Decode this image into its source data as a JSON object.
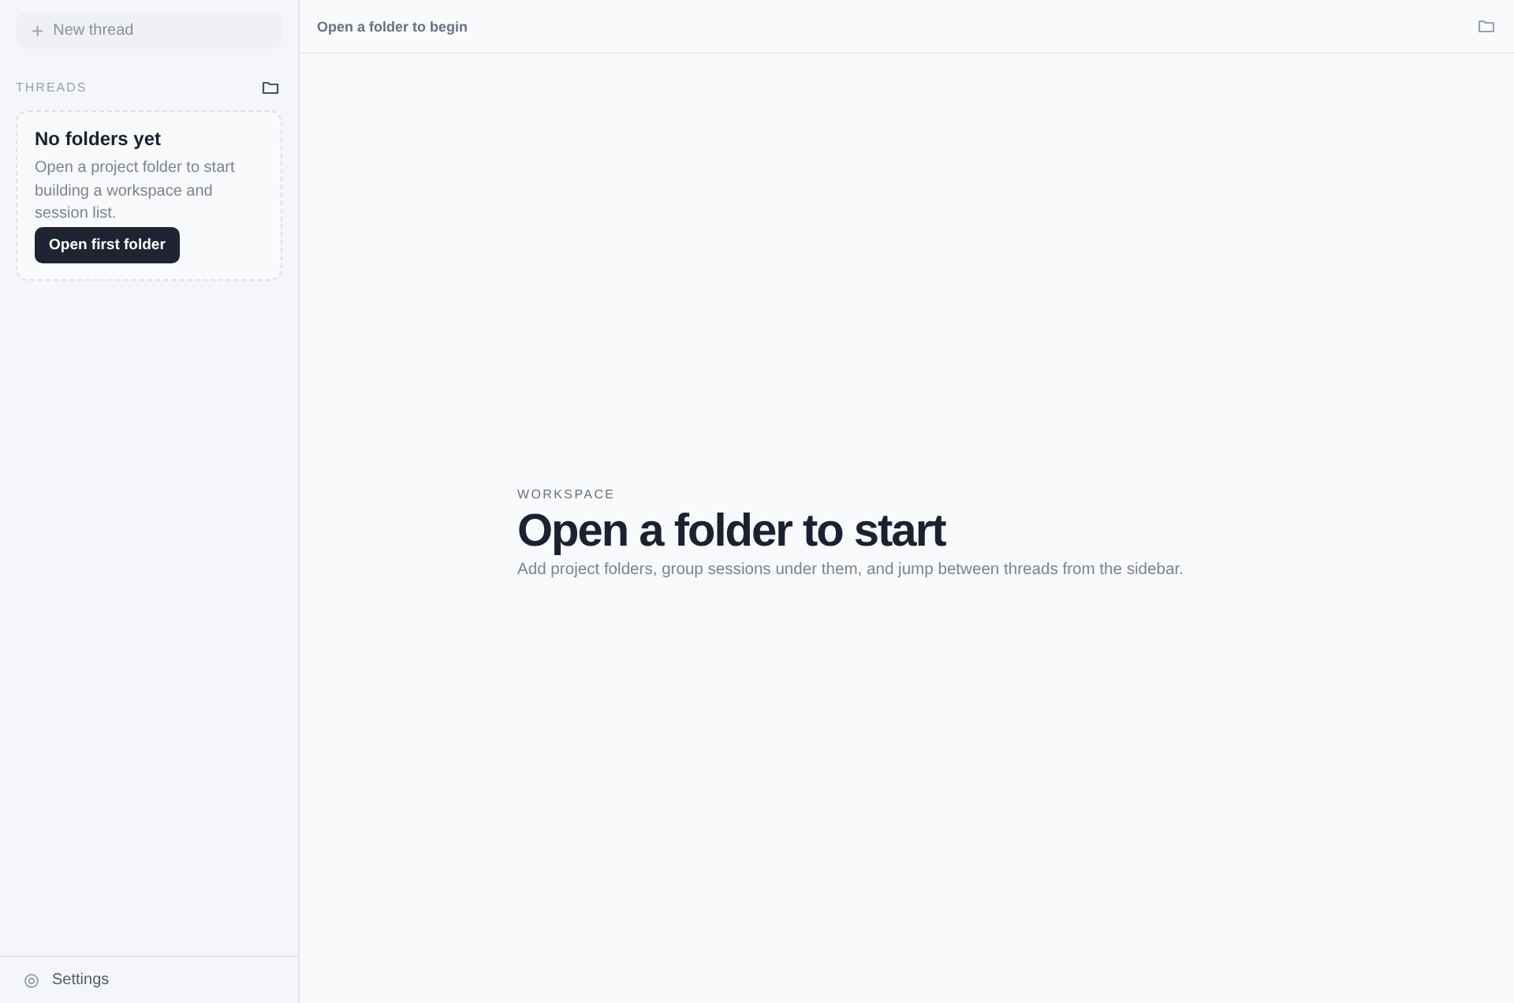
{
  "sidebar": {
    "new_thread_button": {
      "icon": "+",
      "label": "New thread"
    },
    "section_title": "THREADS",
    "empty_card": {
      "title": "No folders yet",
      "text": "Open a project folder to start building a workspace and session list.",
      "button": "Open first folder"
    },
    "settings": "Settings"
  },
  "header": {
    "title": "Open a folder to begin"
  },
  "main": {
    "eyebrow": "WORKSPACE",
    "heading": "Open a folder to start",
    "subtitle": "Add project folders, group sessions under them, and jump between threads from the sidebar."
  }
}
